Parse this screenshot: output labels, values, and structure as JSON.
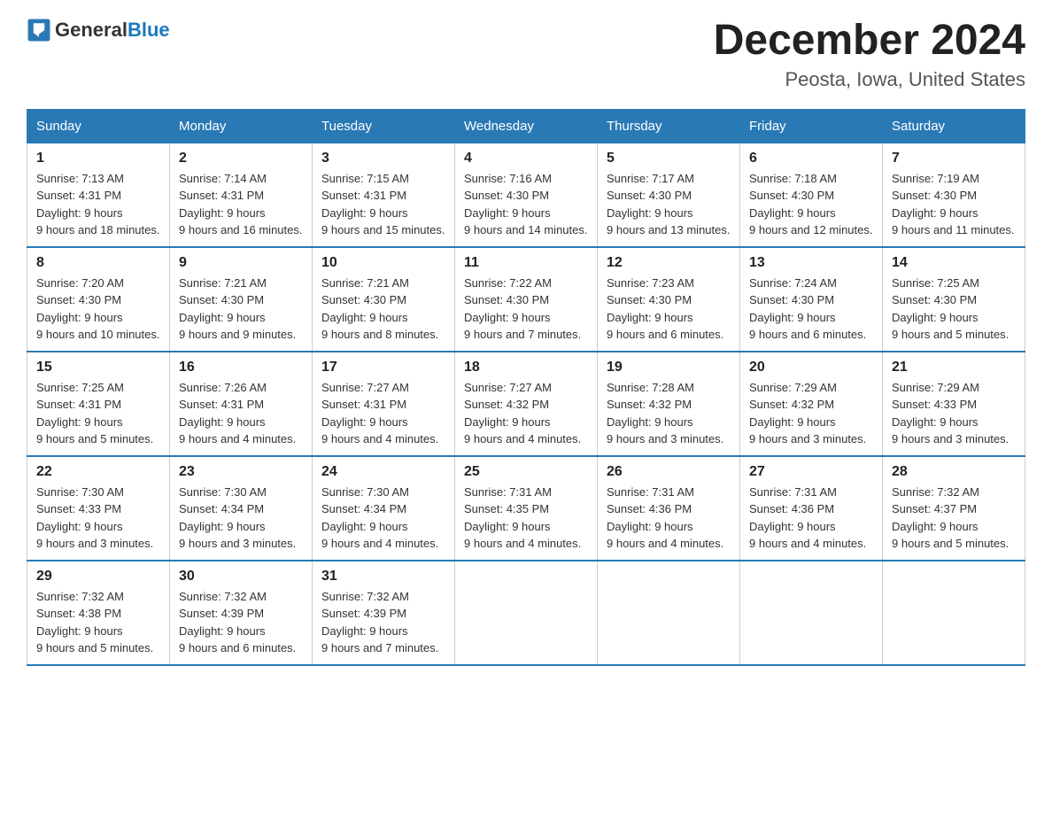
{
  "logo": {
    "general": "General",
    "blue": "Blue"
  },
  "title": "December 2024",
  "subtitle": "Peosta, Iowa, United States",
  "days_of_week": [
    "Sunday",
    "Monday",
    "Tuesday",
    "Wednesday",
    "Thursday",
    "Friday",
    "Saturday"
  ],
  "weeks": [
    [
      {
        "num": "1",
        "sunrise": "7:13 AM",
        "sunset": "4:31 PM",
        "daylight": "9 hours and 18 minutes."
      },
      {
        "num": "2",
        "sunrise": "7:14 AM",
        "sunset": "4:31 PM",
        "daylight": "9 hours and 16 minutes."
      },
      {
        "num": "3",
        "sunrise": "7:15 AM",
        "sunset": "4:31 PM",
        "daylight": "9 hours and 15 minutes."
      },
      {
        "num": "4",
        "sunrise": "7:16 AM",
        "sunset": "4:30 PM",
        "daylight": "9 hours and 14 minutes."
      },
      {
        "num": "5",
        "sunrise": "7:17 AM",
        "sunset": "4:30 PM",
        "daylight": "9 hours and 13 minutes."
      },
      {
        "num": "6",
        "sunrise": "7:18 AM",
        "sunset": "4:30 PM",
        "daylight": "9 hours and 12 minutes."
      },
      {
        "num": "7",
        "sunrise": "7:19 AM",
        "sunset": "4:30 PM",
        "daylight": "9 hours and 11 minutes."
      }
    ],
    [
      {
        "num": "8",
        "sunrise": "7:20 AM",
        "sunset": "4:30 PM",
        "daylight": "9 hours and 10 minutes."
      },
      {
        "num": "9",
        "sunrise": "7:21 AM",
        "sunset": "4:30 PM",
        "daylight": "9 hours and 9 minutes."
      },
      {
        "num": "10",
        "sunrise": "7:21 AM",
        "sunset": "4:30 PM",
        "daylight": "9 hours and 8 minutes."
      },
      {
        "num": "11",
        "sunrise": "7:22 AM",
        "sunset": "4:30 PM",
        "daylight": "9 hours and 7 minutes."
      },
      {
        "num": "12",
        "sunrise": "7:23 AM",
        "sunset": "4:30 PM",
        "daylight": "9 hours and 6 minutes."
      },
      {
        "num": "13",
        "sunrise": "7:24 AM",
        "sunset": "4:30 PM",
        "daylight": "9 hours and 6 minutes."
      },
      {
        "num": "14",
        "sunrise": "7:25 AM",
        "sunset": "4:30 PM",
        "daylight": "9 hours and 5 minutes."
      }
    ],
    [
      {
        "num": "15",
        "sunrise": "7:25 AM",
        "sunset": "4:31 PM",
        "daylight": "9 hours and 5 minutes."
      },
      {
        "num": "16",
        "sunrise": "7:26 AM",
        "sunset": "4:31 PM",
        "daylight": "9 hours and 4 minutes."
      },
      {
        "num": "17",
        "sunrise": "7:27 AM",
        "sunset": "4:31 PM",
        "daylight": "9 hours and 4 minutes."
      },
      {
        "num": "18",
        "sunrise": "7:27 AM",
        "sunset": "4:32 PM",
        "daylight": "9 hours and 4 minutes."
      },
      {
        "num": "19",
        "sunrise": "7:28 AM",
        "sunset": "4:32 PM",
        "daylight": "9 hours and 3 minutes."
      },
      {
        "num": "20",
        "sunrise": "7:29 AM",
        "sunset": "4:32 PM",
        "daylight": "9 hours and 3 minutes."
      },
      {
        "num": "21",
        "sunrise": "7:29 AM",
        "sunset": "4:33 PM",
        "daylight": "9 hours and 3 minutes."
      }
    ],
    [
      {
        "num": "22",
        "sunrise": "7:30 AM",
        "sunset": "4:33 PM",
        "daylight": "9 hours and 3 minutes."
      },
      {
        "num": "23",
        "sunrise": "7:30 AM",
        "sunset": "4:34 PM",
        "daylight": "9 hours and 3 minutes."
      },
      {
        "num": "24",
        "sunrise": "7:30 AM",
        "sunset": "4:34 PM",
        "daylight": "9 hours and 4 minutes."
      },
      {
        "num": "25",
        "sunrise": "7:31 AM",
        "sunset": "4:35 PM",
        "daylight": "9 hours and 4 minutes."
      },
      {
        "num": "26",
        "sunrise": "7:31 AM",
        "sunset": "4:36 PM",
        "daylight": "9 hours and 4 minutes."
      },
      {
        "num": "27",
        "sunrise": "7:31 AM",
        "sunset": "4:36 PM",
        "daylight": "9 hours and 4 minutes."
      },
      {
        "num": "28",
        "sunrise": "7:32 AM",
        "sunset": "4:37 PM",
        "daylight": "9 hours and 5 minutes."
      }
    ],
    [
      {
        "num": "29",
        "sunrise": "7:32 AM",
        "sunset": "4:38 PM",
        "daylight": "9 hours and 5 minutes."
      },
      {
        "num": "30",
        "sunrise": "7:32 AM",
        "sunset": "4:39 PM",
        "daylight": "9 hours and 6 minutes."
      },
      {
        "num": "31",
        "sunrise": "7:32 AM",
        "sunset": "4:39 PM",
        "daylight": "9 hours and 7 minutes."
      },
      null,
      null,
      null,
      null
    ]
  ]
}
